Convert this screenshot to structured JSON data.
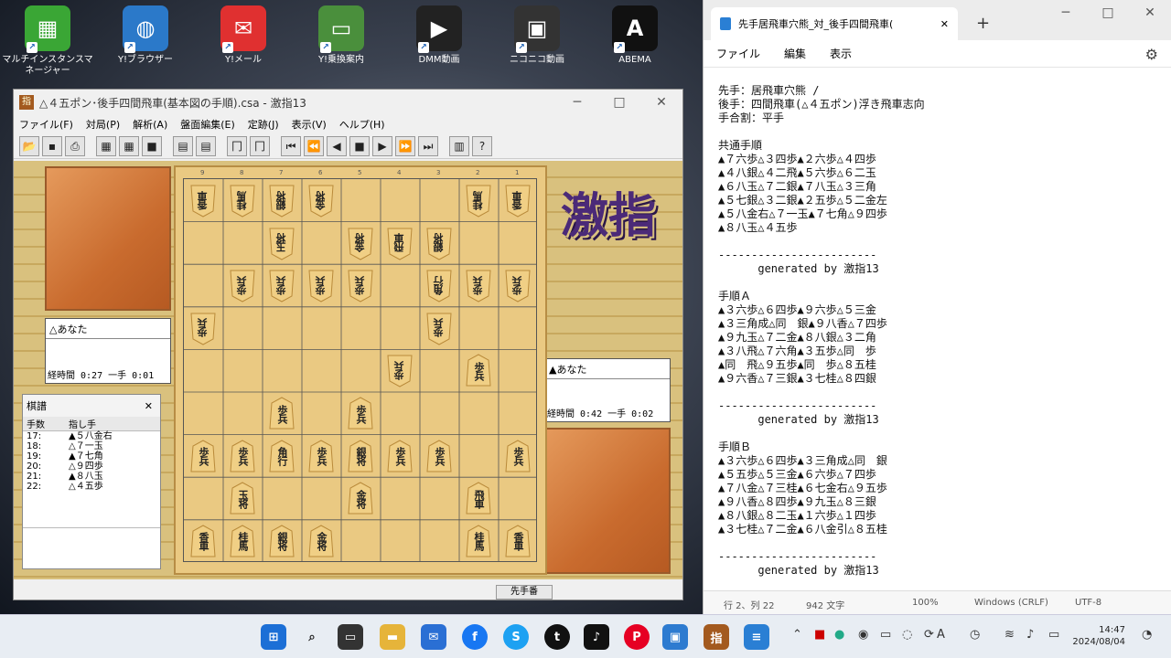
{
  "desktop_icons": [
    {
      "label": "マルチインスタンスマネージャー",
      "color": "#3aa635",
      "glyph": "▦"
    },
    {
      "label": "Y!ブラウザー",
      "color": "#2b79c9",
      "glyph": "◍"
    },
    {
      "label": "Y!メール",
      "color": "#e03030",
      "glyph": "✉"
    },
    {
      "label": "Y!乗換案内",
      "color": "#4a8f3c",
      "glyph": "▭"
    },
    {
      "label": "DMM動画",
      "color": "#222222",
      "glyph": "▶"
    },
    {
      "label": "ニコニコ動画",
      "color": "#333333",
      "glyph": "▣"
    },
    {
      "label": "ABEMA",
      "color": "#111111",
      "glyph": "A"
    }
  ],
  "game_window": {
    "title": "△４五ポン･後手四間飛車(基本図の手順).csa - 激指13",
    "menu": [
      "ファイル(F)",
      "対局(P)",
      "解析(A)",
      "盤面編集(E)",
      "定跡(J)",
      "表示(V)",
      "ヘルプ(H)"
    ],
    "top_player": {
      "name": "△あなた",
      "time": "経時間 0:27 一手 0:01"
    },
    "bottom_player": {
      "name": "▲あなた",
      "time": "経時間 0:42 一手 0:02"
    },
    "logo": "激指",
    "status": "先手番",
    "kifu": {
      "title": "棋譜",
      "headers": [
        "手数",
        "指し手"
      ],
      "rows": [
        [
          "17:",
          "▲５八金右"
        ],
        [
          "18:",
          "△７一玉"
        ],
        [
          "19:",
          "▲７七角"
        ],
        [
          "20:",
          "△９四歩"
        ],
        [
          "21:",
          "▲８八玉"
        ],
        [
          "22:",
          "△４五歩"
        ]
      ]
    },
    "board": {
      "col_numbers": [
        "9",
        "8",
        "7",
        "6",
        "5",
        "4",
        "3",
        "2",
        "1"
      ],
      "pieces": [
        {
          "r": 0,
          "c": 0,
          "t": "香車",
          "o": "g"
        },
        {
          "r": 0,
          "c": 1,
          "t": "桂馬",
          "o": "g"
        },
        {
          "r": 0,
          "c": 2,
          "t": "銀将",
          "o": "g"
        },
        {
          "r": 0,
          "c": 3,
          "t": "金将",
          "o": "g"
        },
        {
          "r": 0,
          "c": 7,
          "t": "桂馬",
          "o": "g"
        },
        {
          "r": 0,
          "c": 8,
          "t": "香車",
          "o": "g"
        },
        {
          "r": 1,
          "c": 2,
          "t": "玉将",
          "o": "g"
        },
        {
          "r": 1,
          "c": 4,
          "t": "金将",
          "o": "g"
        },
        {
          "r": 1,
          "c": 5,
          "t": "飛車",
          "o": "g"
        },
        {
          "r": 1,
          "c": 6,
          "t": "銀将",
          "o": "g"
        },
        {
          "r": 2,
          "c": 1,
          "t": "歩兵",
          "o": "g"
        },
        {
          "r": 2,
          "c": 2,
          "t": "歩兵",
          "o": "g"
        },
        {
          "r": 2,
          "c": 3,
          "t": "歩兵",
          "o": "g"
        },
        {
          "r": 2,
          "c": 4,
          "t": "歩兵",
          "o": "g"
        },
        {
          "r": 2,
          "c": 6,
          "t": "角行",
          "o": "g"
        },
        {
          "r": 2,
          "c": 7,
          "t": "歩兵",
          "o": "g"
        },
        {
          "r": 2,
          "c": 8,
          "t": "歩兵",
          "o": "g"
        },
        {
          "r": 3,
          "c": 0,
          "t": "歩兵",
          "o": "g"
        },
        {
          "r": 3,
          "c": 6,
          "t": "歩兵",
          "o": "g"
        },
        {
          "r": 4,
          "c": 5,
          "t": "歩兵",
          "o": "g"
        },
        {
          "r": 4,
          "c": 7,
          "t": "歩兵",
          "o": "s"
        },
        {
          "r": 5,
          "c": 2,
          "t": "歩兵",
          "o": "s"
        },
        {
          "r": 5,
          "c": 4,
          "t": "歩兵",
          "o": "s"
        },
        {
          "r": 6,
          "c": 0,
          "t": "歩兵",
          "o": "s"
        },
        {
          "r": 6,
          "c": 1,
          "t": "歩兵",
          "o": "s"
        },
        {
          "r": 6,
          "c": 2,
          "t": "角行",
          "o": "s"
        },
        {
          "r": 6,
          "c": 3,
          "t": "歩兵",
          "o": "s"
        },
        {
          "r": 6,
          "c": 4,
          "t": "銀将",
          "o": "s"
        },
        {
          "r": 6,
          "c": 5,
          "t": "歩兵",
          "o": "s"
        },
        {
          "r": 6,
          "c": 6,
          "t": "歩兵",
          "o": "s"
        },
        {
          "r": 6,
          "c": 8,
          "t": "歩兵",
          "o": "s"
        },
        {
          "r": 7,
          "c": 1,
          "t": "玉将",
          "o": "s"
        },
        {
          "r": 7,
          "c": 4,
          "t": "金将",
          "o": "s"
        },
        {
          "r": 7,
          "c": 7,
          "t": "飛車",
          "o": "s"
        },
        {
          "r": 8,
          "c": 0,
          "t": "香車",
          "o": "s"
        },
        {
          "r": 8,
          "c": 1,
          "t": "桂馬",
          "o": "s"
        },
        {
          "r": 8,
          "c": 2,
          "t": "銀将",
          "o": "s"
        },
        {
          "r": 8,
          "c": 3,
          "t": "金将",
          "o": "s"
        },
        {
          "r": 8,
          "c": 7,
          "t": "桂馬",
          "o": "s"
        },
        {
          "r": 8,
          "c": 8,
          "t": "香車",
          "o": "s"
        }
      ]
    }
  },
  "notepad": {
    "tab_title": "先手居飛車穴熊_対_後手四間飛車(",
    "menu": [
      "ファイル",
      "編集",
      "表示"
    ],
    "content": "先手：居飛車穴熊 /\n後手：四間飛車(△４五ポン)浮き飛車志向\n手合割：平手\n\n共通手順\n▲７六歩△３四歩▲２六歩△４四歩\n▲４八銀△４二飛▲５六歩△６二玉\n▲６八玉△７二銀▲７八玉△３三角\n▲５七銀△３二銀▲２五歩△５二金左\n▲５八金右△７一玉▲７七角△９四歩\n▲８八玉△４五歩\n\n------------------------\n      generated by 激指13\n\n手順Ａ\n▲３六歩△６四歩▲９六歩△５三金\n▲３三角成△同　銀▲９八香△７四歩\n▲９九玉△７二金▲８八銀△３二角\n▲３八飛△７六角▲３五歩△同　歩\n▲同　飛△９五歩▲同　歩△８五桂\n▲９六香△７三銀▲３七桂△８四銀\n\n------------------------\n      generated by 激指13\n\n手順Ｂ\n▲３六歩△６四歩▲３三角成△同　銀\n▲５五歩△５三金▲６六歩△７四歩\n▲７八金△７三桂▲６七金右△９五歩\n▲９八香△８四歩▲９九玉△８三銀\n▲８八銀△８二玉▲１六歩△１四歩\n▲３七桂△７二金▲６八金引△８五桂\n\n------------------------\n      generated by 激指13",
    "status": {
      "pos": "行 2、列 22",
      "chars": "942 文字",
      "zoom": "100%",
      "eol": "Windows (CRLF)",
      "enc": "UTF-8"
    }
  },
  "taskbar": {
    "time": "14:47",
    "date": "2024/08/04",
    "ime": "A"
  }
}
